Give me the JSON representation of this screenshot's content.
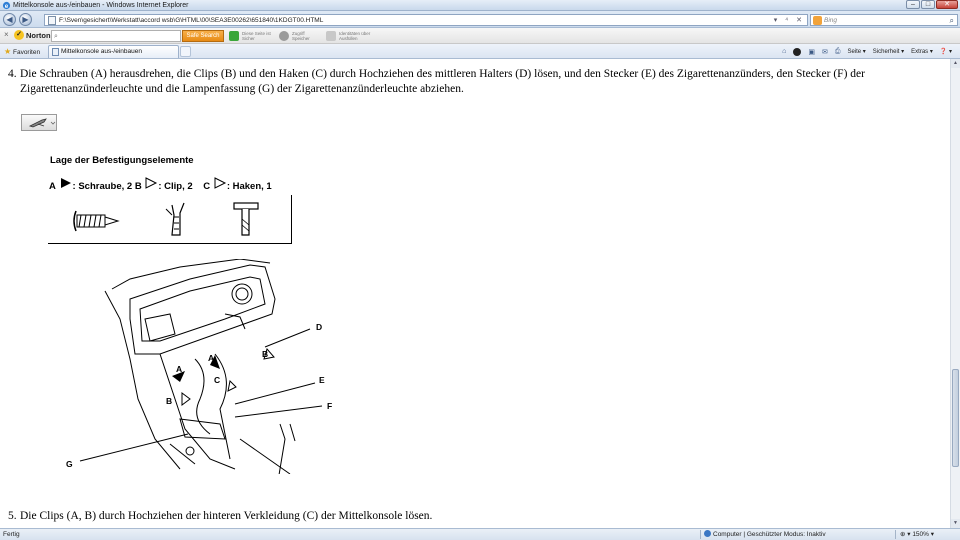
{
  "window": {
    "title": "Mittelkonsole aus-/einbauen - Windows Internet Explorer",
    "buttons": {
      "minimize": "–",
      "maximize": "□",
      "close": "✕"
    }
  },
  "addressbar": {
    "back": "◀",
    "forward": "▶",
    "url": "F:\\Sven\\gesichert\\Werkstatt\\accord wsb\\G\\HTML\\00\\SEA3E00262\\651840\\1KDGT00.HTML",
    "icons": "▾ ⁴ ✕",
    "search_placeholder": "Bing",
    "search_icon": "⌕"
  },
  "norton": {
    "close": "×",
    "brand": "Norton",
    "check_glyph": "✓",
    "search_icon": "⌕",
    "safe_search": "Safe Search",
    "tool1_line1": "Diese Seite ist",
    "tool1_line2": "Sicher",
    "tool2_line1": "Zugriff",
    "tool2_line2": "Speicher",
    "tool3_line1": "Identitäten über",
    "tool3_line2": "Ausfüllen",
    "tool1_color": "#3aa63a",
    "tool2_color": "#9a9a9a"
  },
  "favorites": {
    "star": "★",
    "label": "Favoriten",
    "tab_title": "Mittelkonsole aus-/einbauen"
  },
  "commandbar": {
    "home": "⌂",
    "feeds": "▣",
    "mail": "✉",
    "print": "⎙",
    "page": "Seite ▾",
    "safety": "Sicherheit ▾",
    "extras": "Extras ▾",
    "help": "❓ ▾"
  },
  "content": {
    "step4_num": "4.",
    "step4_text_a": "Die Schrauben (A) herausdrehen, die Clips (B) und den Haken (C) durch Hochziehen des mittleren Halters (D) lösen, und den Stecker (E) des Zigarettenanzünders, den Stecker (F) der",
    "step4_text_b": "Zigarettenanzünderleuchte und die Lampenfassung (G) der Zigarettenanzünderleuchte abziehen.",
    "legend_title": "Lage der Befestigungselemente",
    "legend_a_letter": "A",
    "legend_a_text": ": Schraube, 2",
    "legend_b_letter": "B",
    "legend_b_text": ": Clip, 2",
    "legend_c_letter": "C",
    "legend_c_text": ": Haken, 1",
    "callouts": {
      "A1": "A",
      "A2": "A",
      "B1": "B",
      "B2": "B",
      "C": "C",
      "D": "D",
      "E": "E",
      "F": "F",
      "G": "G"
    },
    "step5_num": "5.",
    "step5_text": "Die Clips (A, B) durch Hochziehen der hinteren Verkleidung (C) der Mittelkonsole lösen."
  },
  "scrollbar": {
    "up": "▲",
    "down": "▼"
  },
  "statusbar": {
    "left": "Fertig",
    "zone": "Computer | Geschützter Modus: Inaktiv",
    "zoom": "⊕ ▾ 150% ▾"
  }
}
